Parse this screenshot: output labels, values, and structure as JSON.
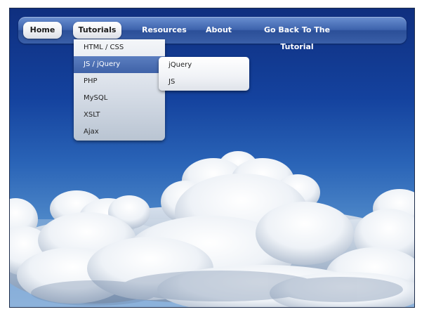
{
  "nav": {
    "home": "Home",
    "tutorials": "Tutorials",
    "resources": "Resources",
    "about": "About",
    "go_back": "Go Back To The Tutorial"
  },
  "tutorials_menu": {
    "items": [
      "HTML / CSS",
      "JS / jQuery",
      "PHP",
      "MySQL",
      "XSLT",
      "Ajax"
    ],
    "active_index": 1
  },
  "js_submenu": {
    "items": [
      "jQuery",
      "JS"
    ]
  },
  "colors": {
    "navbar": "#3d63ad",
    "active_item": "#4a6db3",
    "sky": "#14429e"
  }
}
